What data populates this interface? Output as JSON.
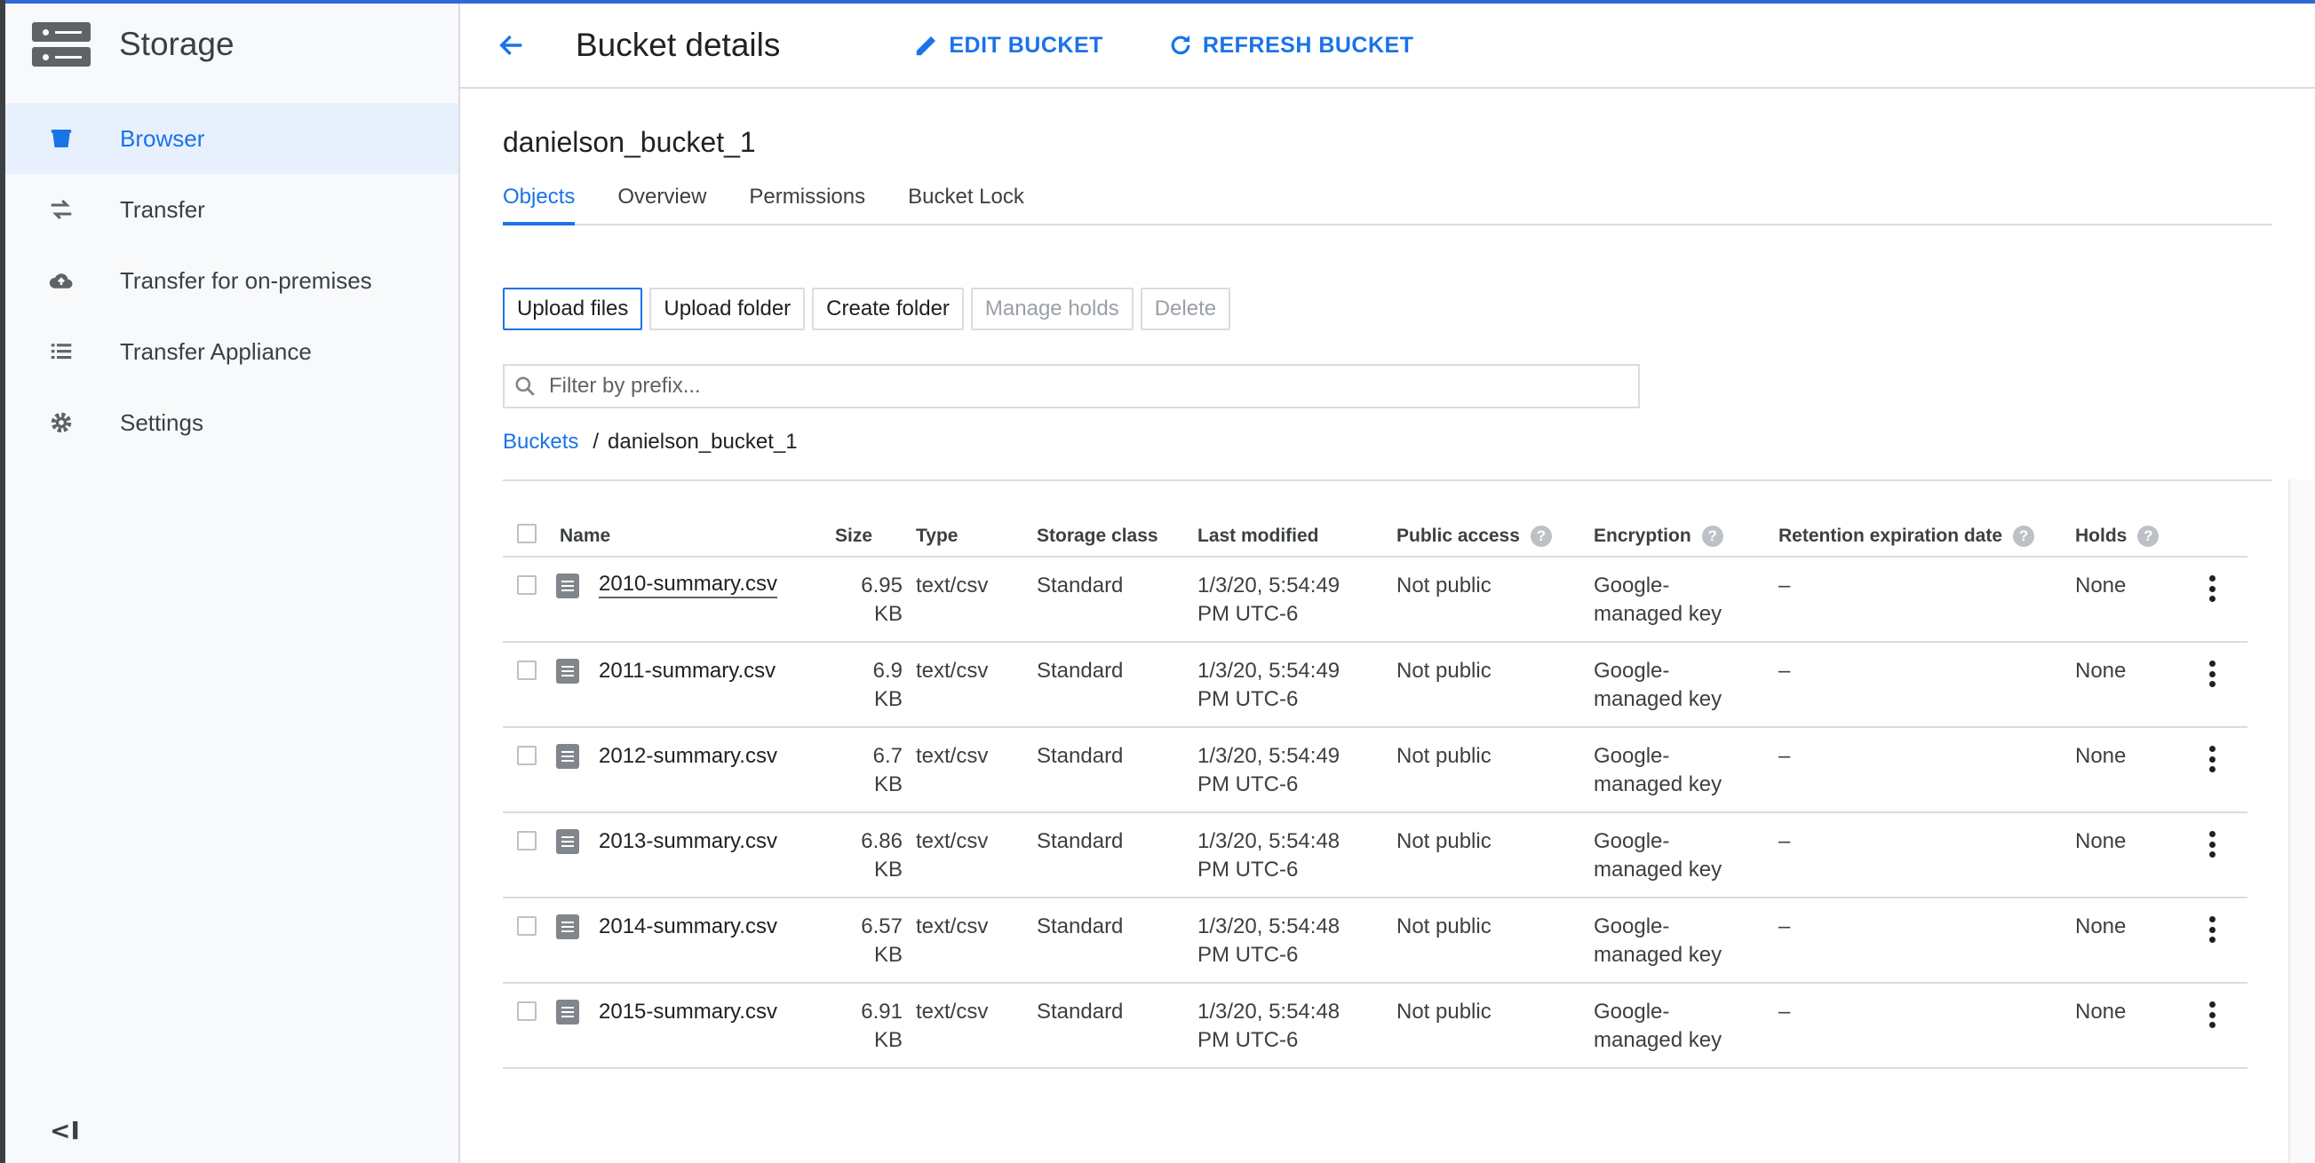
{
  "app": {
    "title": "Storage",
    "logo_icon": "storage-icon"
  },
  "sidebar": {
    "items": [
      {
        "label": "Browser",
        "icon": "bucket-icon",
        "active": true
      },
      {
        "label": "Transfer",
        "icon": "transfer-arrows-icon",
        "active": false
      },
      {
        "label": "Transfer for on-premises",
        "icon": "cloud-upload-icon",
        "active": false
      },
      {
        "label": "Transfer Appliance",
        "icon": "list-icon",
        "active": false
      },
      {
        "label": "Settings",
        "icon": "gear-icon",
        "active": false
      }
    ],
    "collapse_label": "<I"
  },
  "header": {
    "title": "Bucket details",
    "edit_label": "EDIT BUCKET",
    "refresh_label": "REFRESH BUCKET"
  },
  "bucket": {
    "name": "danielson_bucket_1"
  },
  "tabs": [
    {
      "label": "Objects",
      "active": true
    },
    {
      "label": "Overview",
      "active": false
    },
    {
      "label": "Permissions",
      "active": false
    },
    {
      "label": "Bucket Lock",
      "active": false
    }
  ],
  "actions": {
    "upload_files": "Upload files",
    "upload_folder": "Upload folder",
    "create_folder": "Create folder",
    "manage_holds": "Manage holds",
    "delete": "Delete"
  },
  "filter": {
    "placeholder": "Filter by prefix...",
    "value": ""
  },
  "breadcrumb": {
    "root": "Buckets",
    "separator": "/",
    "current": "danielson_bucket_1"
  },
  "table": {
    "columns": {
      "name": "Name",
      "size": "Size",
      "type": "Type",
      "storage_class": "Storage class",
      "last_modified": "Last modified",
      "public_access": "Public access",
      "encryption": "Encryption",
      "retention": "Retention expiration date",
      "holds": "Holds"
    },
    "rows": [
      {
        "name": "2010-summary.csv",
        "size_value": "6.95",
        "size_unit": "KB",
        "type": "text/csv",
        "storage_class": "Standard",
        "modified_line1": "1/3/20, 5:54:49",
        "modified_line2": "PM UTC-6",
        "public_access": "Not public",
        "encryption_line1": "Google-",
        "encryption_line2": "managed key",
        "retention": "–",
        "holds": "None"
      },
      {
        "name": "2011-summary.csv",
        "size_value": "6.9",
        "size_unit": "KB",
        "type": "text/csv",
        "storage_class": "Standard",
        "modified_line1": "1/3/20, 5:54:49",
        "modified_line2": "PM UTC-6",
        "public_access": "Not public",
        "encryption_line1": "Google-",
        "encryption_line2": "managed key",
        "retention": "–",
        "holds": "None"
      },
      {
        "name": "2012-summary.csv",
        "size_value": "6.7",
        "size_unit": "KB",
        "type": "text/csv",
        "storage_class": "Standard",
        "modified_line1": "1/3/20, 5:54:49",
        "modified_line2": "PM UTC-6",
        "public_access": "Not public",
        "encryption_line1": "Google-",
        "encryption_line2": "managed key",
        "retention": "–",
        "holds": "None"
      },
      {
        "name": "2013-summary.csv",
        "size_value": "6.86",
        "size_unit": "KB",
        "type": "text/csv",
        "storage_class": "Standard",
        "modified_line1": "1/3/20, 5:54:48",
        "modified_line2": "PM UTC-6",
        "public_access": "Not public",
        "encryption_line1": "Google-",
        "encryption_line2": "managed key",
        "retention": "–",
        "holds": "None"
      },
      {
        "name": "2014-summary.csv",
        "size_value": "6.57",
        "size_unit": "KB",
        "type": "text/csv",
        "storage_class": "Standard",
        "modified_line1": "1/3/20, 5:54:48",
        "modified_line2": "PM UTC-6",
        "public_access": "Not public",
        "encryption_line1": "Google-",
        "encryption_line2": "managed key",
        "retention": "–",
        "holds": "None"
      },
      {
        "name": "2015-summary.csv",
        "size_value": "6.91",
        "size_unit": "KB",
        "type": "text/csv",
        "storage_class": "Standard",
        "modified_line1": "1/3/20, 5:54:48",
        "modified_line2": "PM UTC-6",
        "public_access": "Not public",
        "encryption_line1": "Google-",
        "encryption_line2": "managed key",
        "retention": "–",
        "holds": "None"
      }
    ]
  },
  "colors": {
    "accent": "#1a73e8",
    "active_nav_bg": "#e8f0fe",
    "top_bar": "#3367d6"
  }
}
